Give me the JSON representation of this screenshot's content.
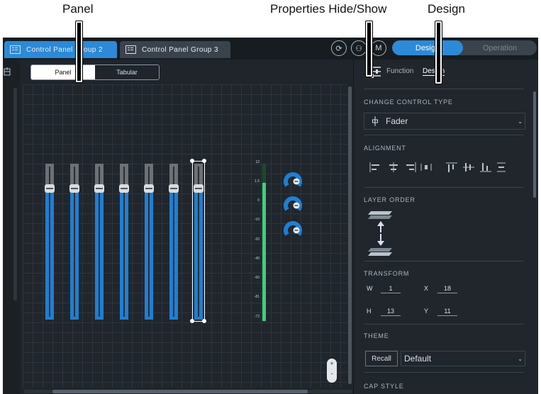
{
  "callouts": {
    "panel": "Panel",
    "properties": "Properties Hide/Show",
    "design": "Design"
  },
  "tabs": [
    {
      "label": "Control Panel Group 2",
      "active": true
    },
    {
      "label": "Control Panel Group 3",
      "active": false
    }
  ],
  "toolbar": {
    "m_label": "M",
    "mode_design": "Design",
    "mode_operation": "Operation"
  },
  "view_toggle": {
    "panel": "Panel",
    "tabular": "Tabular"
  },
  "faders": [
    {
      "level": 0.84
    },
    {
      "level": 0.84
    },
    {
      "level": 0.84
    },
    {
      "level": 0.84
    },
    {
      "level": 0.84
    },
    {
      "level": 0.84
    },
    {
      "level": 0.84,
      "selected": true
    }
  ],
  "meter": {
    "ticks": [
      "12",
      "1.5",
      "0",
      "-10",
      "-20",
      "-40",
      "-60",
      "-81",
      "-72"
    ],
    "level": 0.88
  },
  "zoom": {
    "plus": "+",
    "minus": "-"
  },
  "properties": {
    "tabs": {
      "function": "Function",
      "design": "Design"
    },
    "change_control_type": {
      "heading": "CHANGE CONTROL TYPE",
      "value": "Fader"
    },
    "alignment": {
      "heading": "ALIGNMENT"
    },
    "layer_order": {
      "heading": "LAYER ORDER"
    },
    "transform": {
      "heading": "TRANSFORM",
      "w_label": "W",
      "w_value": "1",
      "x_label": "X",
      "x_value": "18",
      "h_label": "H",
      "h_value": "13",
      "y_label": "Y",
      "y_value": "11"
    },
    "theme": {
      "heading": "THEME",
      "recall": "Recall",
      "value": "Default"
    },
    "next_heading": "CAP STYLE"
  },
  "colors": {
    "accent": "#2c8ad8",
    "fader_fill": "#1f7fd2",
    "meter_green": "#3fd07a",
    "background": "#1f252b"
  }
}
